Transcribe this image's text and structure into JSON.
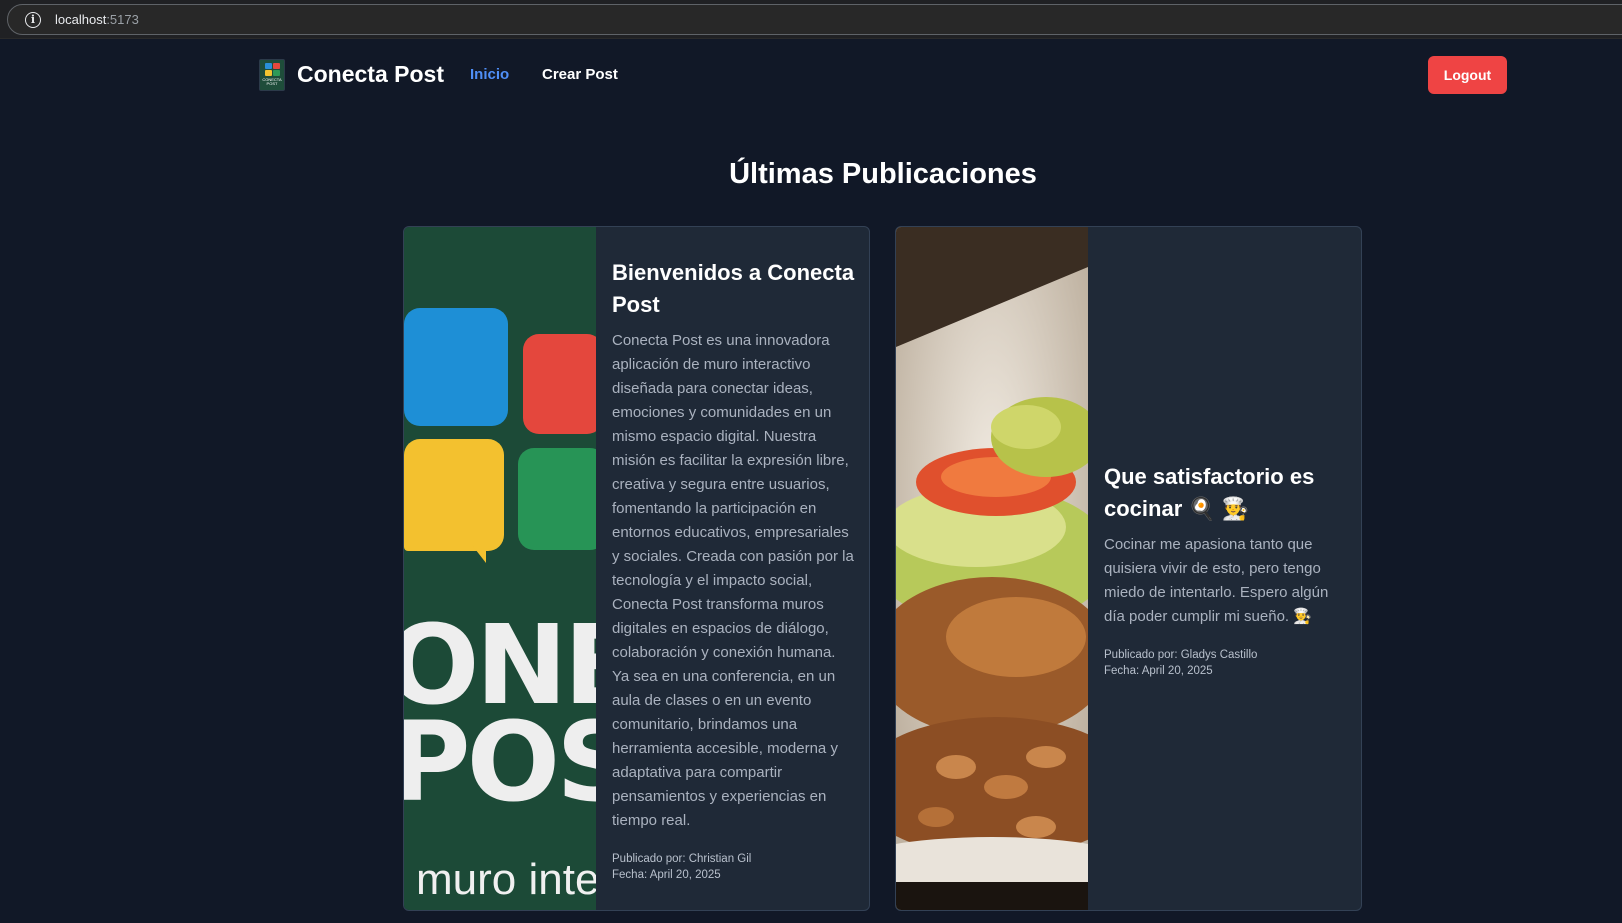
{
  "browser": {
    "url_host": "localhost",
    "url_port": ":5173"
  },
  "nav": {
    "brand": "Conecta Post",
    "links": [
      "Inicio",
      "Crear Post"
    ],
    "active": "Inicio",
    "logout_label": "Logout"
  },
  "page": {
    "title": "Últimas Publicaciones"
  },
  "posts": [
    {
      "title": "Bienvenidos a Conecta Post",
      "body": "Conecta Post es una innovadora aplicación de muro interactivo diseñada para conectar ideas, emociones y comunidades en un mismo espacio digital. Nuestra misión es facilitar la expresión libre, creativa y segura entre usuarios, fomentando la participación en entornos educativos, empresariales y sociales. Creada con pasión por la tecnología y el impacto social, Conecta Post transforma muros digitales en espacios de diálogo, colaboración y conexión humana. Ya sea en una conferencia, en un aula de clases o en un evento comunitario, brindamos una herramienta accesible, moderna y adaptativa para compartir pensamientos y experiencias en tiempo real.",
      "author": "Publicado por: Christian Gil",
      "date": "Fecha: April 20, 2025",
      "image_text_1": "ONEC",
      "image_text_2": "POST",
      "image_text_3": "muro interactivo"
    },
    {
      "title": "Que satisfactorio es cocinar 🍳 👨‍🍳",
      "body": "Cocinar me apasiona tanto que quisiera vivir de esto, pero tengo miedo de intentarlo. Espero algún día poder cumplir mi sueño. 👨‍🍳",
      "author": "Publicado por: Gladys Castillo",
      "date": "Fecha: April 20, 2025"
    }
  ],
  "colors": {
    "background": "#111827",
    "card": "#1f2937",
    "accent": "#4f8ff7",
    "danger": "#ef4444"
  }
}
